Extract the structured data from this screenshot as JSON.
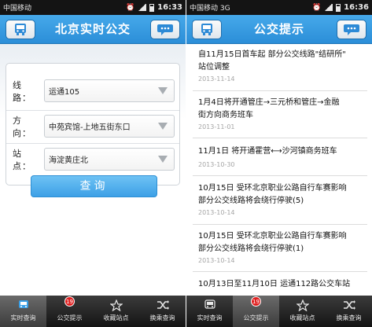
{
  "left": {
    "status": {
      "carrier": "中国移动",
      "time": "16:33"
    },
    "header": {
      "title": "北京实时公交"
    },
    "form": {
      "line_label": "线 路：",
      "line_value": "运通105",
      "direction_label": "方 向：",
      "direction_value": "中苑宾馆-上地五街东口",
      "stop_label": "站 点：",
      "stop_value": "海淀黄庄北"
    },
    "query_label": "查询",
    "tabs": [
      {
        "label": "实时查询"
      },
      {
        "label": "公交提示",
        "badge": "19"
      },
      {
        "label": "收藏站点"
      },
      {
        "label": "换乘查询"
      }
    ]
  },
  "right": {
    "status": {
      "carrier": "中国移动 3G",
      "time": "16:36"
    },
    "header": {
      "title": "公交提示"
    },
    "items": [
      {
        "title_l1": "自11月15日首车起 部分公交线路\"结研所\"",
        "title_l2": "站位调整",
        "date": "2013-11-14"
      },
      {
        "title_l1": "1月4日将开通管庄→三元桥和管庄→金融",
        "title_l2": "街方向商务班车",
        "date": "2013-11-01"
      },
      {
        "title_l1": "11月1日 将开通霍营⟷沙河镇商务班车",
        "title_l2": "",
        "date": "2013-10-30"
      },
      {
        "title_l1": "10月15日 受环北京职业公路自行车赛影响",
        "title_l2": "部分公交线路将会绕行停驶(5)",
        "date": "2013-10-14"
      },
      {
        "title_l1": "10月15日 受环北京职业公路自行车赛影响",
        "title_l2": "部分公交线路将会绕行停驶(1)",
        "date": "2013-10-14"
      },
      {
        "title_l1": "10月13日至11月10日 运通112路公交车站",
        "title_l2": "",
        "date": ""
      }
    ],
    "tabs": [
      {
        "label": "实时查询"
      },
      {
        "label": "公交提示",
        "badge": "19"
      },
      {
        "label": "收藏站点"
      },
      {
        "label": "换乘查询"
      }
    ]
  }
}
